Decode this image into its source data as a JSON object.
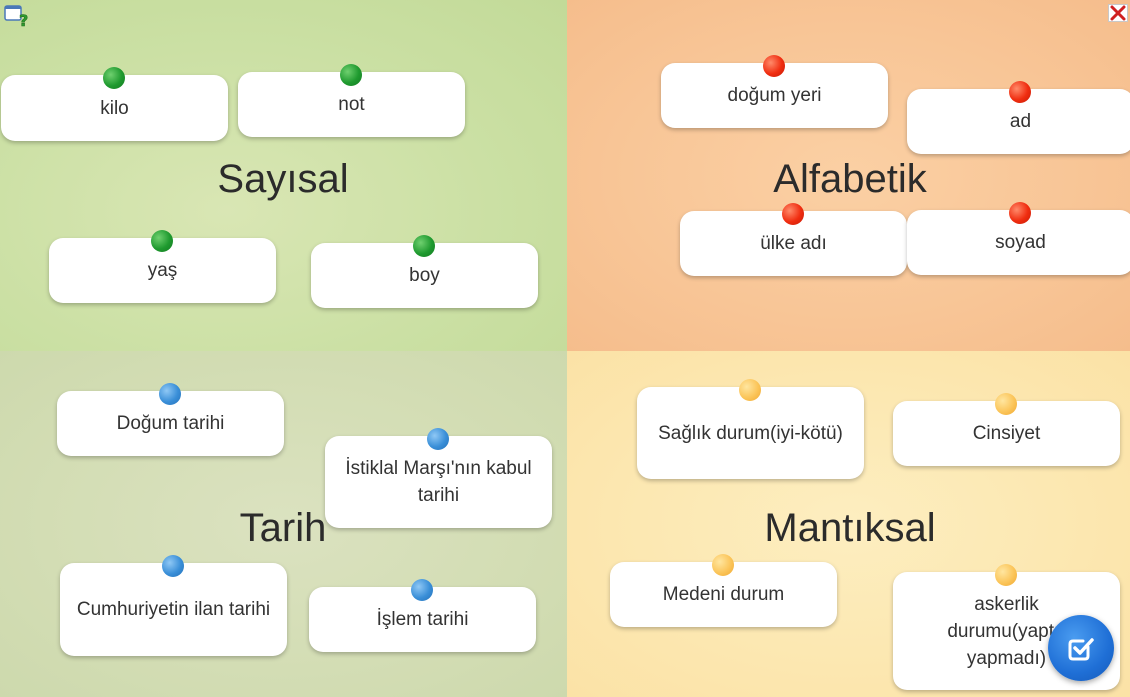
{
  "categories": [
    {
      "title": "Sayısal"
    },
    {
      "title": "Alfabetik"
    },
    {
      "title": "Tarih"
    },
    {
      "title": "Mantıksal"
    }
  ],
  "cards": [
    {
      "label": "kilo",
      "pin_color": "green"
    },
    {
      "label": "not",
      "pin_color": "green"
    },
    {
      "label": "yaş",
      "pin_color": "green"
    },
    {
      "label": "boy",
      "pin_color": "green"
    },
    {
      "label": "doğum yeri",
      "pin_color": "red"
    },
    {
      "label": "ad",
      "pin_color": "red"
    },
    {
      "label": "ülke adı",
      "pin_color": "red"
    },
    {
      "label": "soyad",
      "pin_color": "red"
    },
    {
      "label": "Doğum tarihi",
      "pin_color": "blue"
    },
    {
      "label": "İstiklal Marşı'nın kabul tarihi",
      "pin_color": "blue"
    },
    {
      "label": "Cumhuriyetin ilan tarihi",
      "pin_color": "blue"
    },
    {
      "label": "İşlem tarihi",
      "pin_color": "blue"
    },
    {
      "label": "Sağlık durum(iyi-kötü)",
      "pin_color": "yellow"
    },
    {
      "label": "Cinsiyet",
      "pin_color": "yellow"
    },
    {
      "label": "Medeni durum",
      "pin_color": "yellow"
    },
    {
      "label": "askerlik durumu(yaptı-yapmadı)",
      "pin_color": "yellow"
    }
  ],
  "icons": {
    "help": "help-icon",
    "close": "close-icon",
    "check": "check-icon"
  },
  "colors": {
    "sayisal_bg": "#c9dfa2",
    "alfabetik_bg": "#f8c596",
    "tarih_bg": "#d3ddb4",
    "mantiksal_bg": "#fce7b0",
    "pin_green": "#1f9a2f",
    "pin_red": "#f02d10",
    "pin_blue": "#3a8fd8",
    "pin_yellow": "#fbc55a",
    "check_button": "#1f6fd6"
  }
}
